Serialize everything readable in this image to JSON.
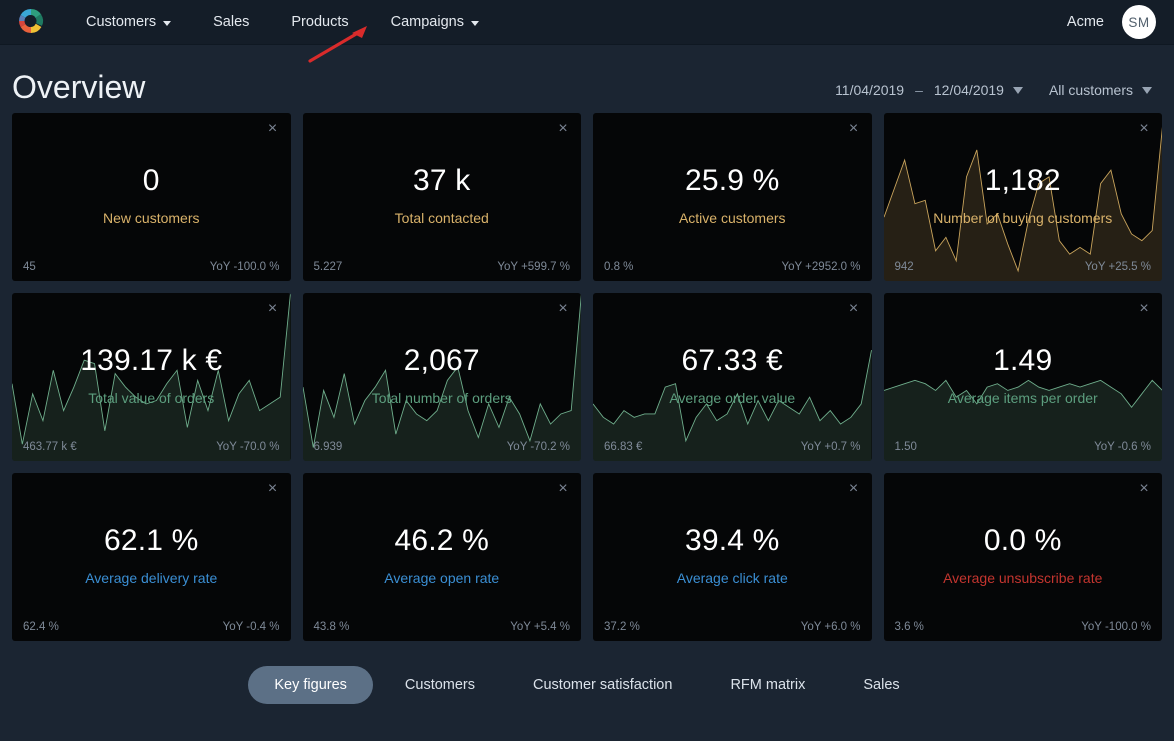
{
  "nav": {
    "logo_icon": "pie-chart-logo",
    "items": [
      {
        "label": "Customers",
        "has_caret": true
      },
      {
        "label": "Sales",
        "has_caret": false
      },
      {
        "label": "Products",
        "has_caret": false
      },
      {
        "label": "Campaigns",
        "has_caret": true
      }
    ],
    "account_name": "Acme",
    "avatar_initials": "SM"
  },
  "annotation": {
    "type": "red-arrow",
    "points_at": "Campaigns",
    "color": "#d92b2b"
  },
  "header": {
    "title": "Overview",
    "date_from": "11/04/2019",
    "date_separator": "–",
    "date_to": "12/04/2019",
    "segment": "All customers"
  },
  "cards": [
    {
      "value": "0",
      "label": "New customers",
      "label_color": "#d9b26a",
      "prev": "45",
      "yoy": "YoY -100.0 %",
      "chart": null
    },
    {
      "value": "37 k",
      "label": "Total contacted",
      "label_color": "#d9b26a",
      "prev": "5.227",
      "yoy": "YoY +599.7 %",
      "chart": null
    },
    {
      "value": "25.9 %",
      "label": "Active customers",
      "label_color": "#d9b26a",
      "prev": "0.8 %",
      "yoy": "YoY +2952.0 %",
      "chart": null
    },
    {
      "value": "1,182",
      "label": "Number of buying customers",
      "label_color": "#d9b26a",
      "prev": "942",
      "yoy": "YoY +25.5 %",
      "chart": {
        "stroke": "#c9a45c",
        "fill": "rgba(201,164,92,0.17)",
        "points": [
          38,
          55,
          72,
          46,
          48,
          18,
          26,
          12,
          62,
          78,
          34,
          40,
          22,
          6,
          36,
          58,
          62,
          24,
          16,
          20,
          16,
          58,
          66,
          40,
          28,
          24,
          30,
          92
        ]
      }
    },
    {
      "value": "139.17 k €",
      "label": "Total value of orders",
      "label_color": "#5c9e7e",
      "prev": "463.77 k €",
      "yoy": "YoY -70.0 %",
      "chart": {
        "stroke": "#6fae8c",
        "fill": "rgba(111,174,140,0.16)",
        "points": [
          46,
          10,
          40,
          24,
          54,
          30,
          44,
          60,
          58,
          18,
          52,
          44,
          38,
          34,
          36,
          46,
          54,
          20,
          48,
          30,
          54,
          24,
          40,
          48,
          30,
          34,
          38,
          100
        ]
      }
    },
    {
      "value": "2,067",
      "label": "Total number of orders",
      "label_color": "#5c9e7e",
      "prev": "6.939",
      "yoy": "YoY -70.2 %",
      "chart": {
        "stroke": "#6fae8c",
        "fill": "rgba(111,174,140,0.16)",
        "points": [
          44,
          8,
          42,
          26,
          52,
          22,
          36,
          44,
          54,
          16,
          36,
          28,
          24,
          30,
          48,
          56,
          30,
          14,
          34,
          20,
          38,
          28,
          12,
          34,
          22,
          28,
          30,
          100
        ]
      }
    },
    {
      "value": "67.33 €",
      "label": "Average order value",
      "label_color": "#5c9e7e",
      "prev": "66.83 €",
      "yoy": "YoY +0.7 %",
      "chart": {
        "stroke": "#6fae8c",
        "fill": "rgba(111,174,140,0.16)",
        "points": [
          34,
          26,
          22,
          30,
          26,
          28,
          28,
          44,
          46,
          12,
          26,
          34,
          24,
          28,
          40,
          22,
          36,
          24,
          36,
          32,
          28,
          38,
          24,
          30,
          22,
          26,
          34,
          66
        ]
      }
    },
    {
      "value": "1.49",
      "label": "Average items per order",
      "label_color": "#5c9e7e",
      "prev": "1.50",
      "yoy": "YoY -0.6 %",
      "chart": {
        "stroke": "#6fae8c",
        "fill": "rgba(111,174,140,0.16)",
        "points": [
          42,
          44,
          46,
          48,
          46,
          42,
          48,
          38,
          42,
          34,
          44,
          46,
          42,
          44,
          48,
          44,
          42,
          44,
          46,
          44,
          46,
          48,
          44,
          40,
          32,
          40,
          48,
          42
        ]
      }
    },
    {
      "value": "62.1 %",
      "label": "Average delivery rate",
      "label_color": "#3b8fd4",
      "prev": "62.4 %",
      "yoy": "YoY -0.4 %",
      "chart": null
    },
    {
      "value": "46.2 %",
      "label": "Average open rate",
      "label_color": "#3b8fd4",
      "prev": "43.8 %",
      "yoy": "YoY +5.4 %",
      "chart": null
    },
    {
      "value": "39.4 %",
      "label": "Average click rate",
      "label_color": "#3b8fd4",
      "prev": "37.2 %",
      "yoy": "YoY +6.0 %",
      "chart": null
    },
    {
      "value": "0.0 %",
      "label": "Average unsubscribe rate",
      "label_color": "#c4352f",
      "prev": "3.6 %",
      "yoy": "YoY -100.0 %",
      "chart": null
    }
  ],
  "tabs": [
    {
      "label": "Key figures",
      "active": true
    },
    {
      "label": "Customers",
      "active": false
    },
    {
      "label": "Customer satisfaction",
      "active": false
    },
    {
      "label": "RFM matrix",
      "active": false
    },
    {
      "label": "Sales",
      "active": false
    }
  ],
  "icons": {
    "close": "×"
  }
}
